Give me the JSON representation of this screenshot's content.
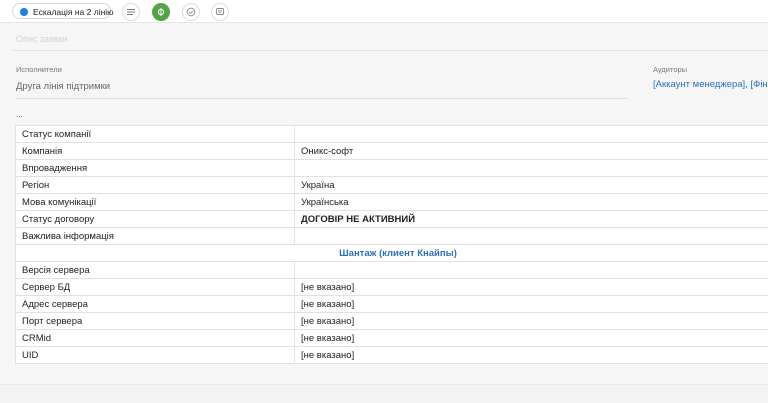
{
  "toolbar": {
    "status_label": "Ескалація на 2 лінію"
  },
  "form": {
    "description_placeholder": "Опис заявки",
    "executors_label": "Исполнители",
    "executors_value": "Друга лінія підтримки",
    "auditors_label": "Аудиторы",
    "auditors_value": "[Аккаунт менеджера], [Фін",
    "ellipsis": "..."
  },
  "info": {
    "rows": [
      {
        "key": "Статус компанії",
        "value": ""
      },
      {
        "key": "Компанія",
        "value": "Оникс-софт"
      },
      {
        "key": "Впровадження",
        "value": ""
      },
      {
        "key": "Регіон",
        "value": "Україна"
      },
      {
        "key": "Мова комунікації",
        "value": "Українська"
      },
      {
        "key": "Статус договору",
        "value": "ДОГОВІР НЕ АКТИВНИЙ"
      },
      {
        "key": "Важлива інформація",
        "value": ""
      },
      {
        "key": "",
        "value": "Шантаж (клиент Кнайпы)"
      },
      {
        "key": "Версія сервера",
        "value": ""
      },
      {
        "key": "Сервер БД",
        "value": "[не вказано]"
      },
      {
        "key": "Адрес сервера",
        "value": "[не вказано]"
      },
      {
        "key": "Порт сервера",
        "value": "[не вказано]"
      },
      {
        "key": "CRMid",
        "value": "[не вказано]"
      },
      {
        "key": "UID",
        "value": "[не вказано]"
      }
    ]
  },
  "colors": {
    "accent_green": "#52a447",
    "status_dot": "#1e7fe0",
    "link_blue": "#2a70bf",
    "alert_red": "#e3342f"
  }
}
